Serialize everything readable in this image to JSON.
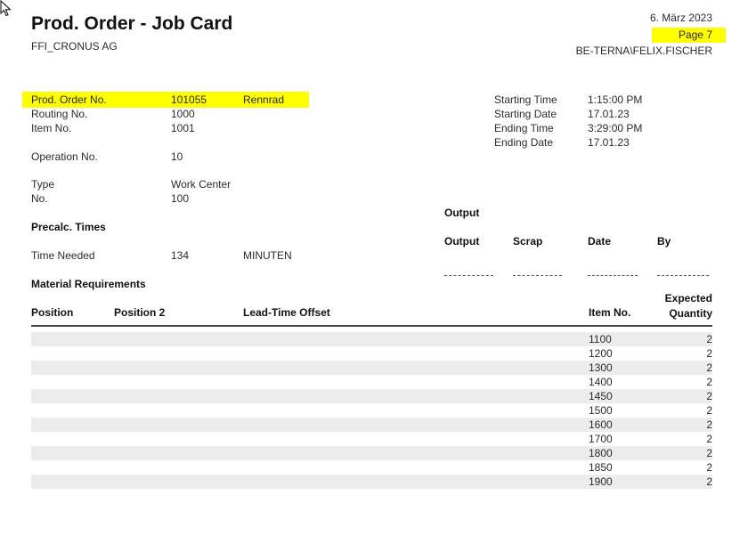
{
  "report": {
    "title": "Prod. Order - Job Card",
    "company": "FFI_CRONUS AG",
    "date": "6. März 2023",
    "page": "Page 7",
    "user": "BE-TERNA\\FELIX.FISCHER"
  },
  "header": {
    "prod_order_label": "Prod. Order No.",
    "prod_order_value": "101055",
    "prod_order_desc": "Rennrad",
    "routing_label": "Routing No.",
    "routing_value": "1000",
    "item_label": "Item No.",
    "item_value": "1001",
    "operation_label": "Operation No.",
    "operation_value": "10",
    "type_label": "Type",
    "type_value": "Work Center",
    "no_label": "No.",
    "no_value": "100"
  },
  "times": {
    "starting_time_label": "Starting Time",
    "starting_time_value": "1:15:00 PM",
    "starting_date_label": "Starting Date",
    "starting_date_value": "17.01.23",
    "ending_time_label": "Ending Time",
    "ending_time_value": "3:29:00 PM",
    "ending_date_label": "Ending Date",
    "ending_date_value": "17.01.23"
  },
  "precalc": {
    "heading": "Precalc. Times",
    "time_needed_label": "Time Needed",
    "time_needed_value": "134",
    "time_needed_unit": "MINUTEN"
  },
  "output": {
    "heading": "Output",
    "col_output": "Output",
    "col_scrap": "Scrap",
    "col_date": "Date",
    "col_by": "By"
  },
  "materials": {
    "heading": "Material Requirements",
    "col_position": "Position",
    "col_position2": "Position 2",
    "col_leadtime": "Lead-Time Offset",
    "col_item": "Item No.",
    "col_expected_1": "Expected",
    "col_expected_2": "Quantity",
    "rows": [
      {
        "item": "1100",
        "qty": "2"
      },
      {
        "item": "1200",
        "qty": "2"
      },
      {
        "item": "1300",
        "qty": "2"
      },
      {
        "item": "1400",
        "qty": "2"
      },
      {
        "item": "1450",
        "qty": "2"
      },
      {
        "item": "1500",
        "qty": "2"
      },
      {
        "item": "1600",
        "qty": "2"
      },
      {
        "item": "1700",
        "qty": "2"
      },
      {
        "item": "1800",
        "qty": "2"
      },
      {
        "item": "1850",
        "qty": "2"
      },
      {
        "item": "1900",
        "qty": "2"
      }
    ]
  },
  "colors": {
    "highlight": "#ffff00",
    "row_shade": "#ececec"
  }
}
